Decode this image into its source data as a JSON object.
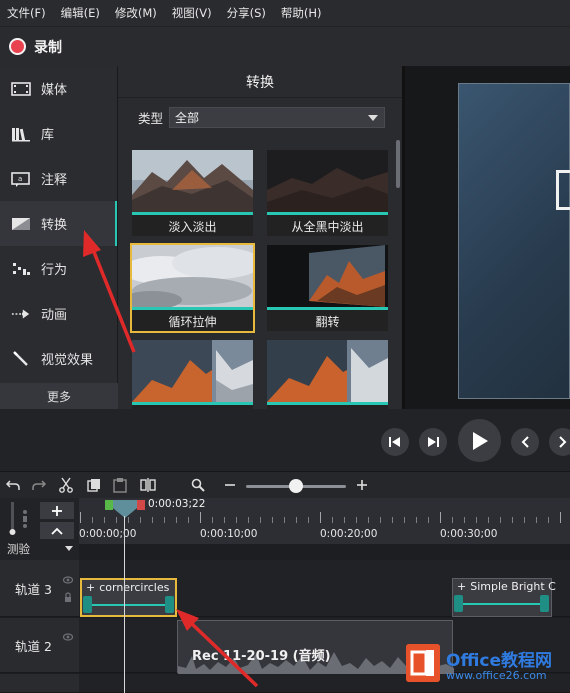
{
  "menu": [
    "文件(F)",
    "编辑(E)",
    "修改(M)",
    "视图(V)",
    "分享(S)",
    "帮助(H)"
  ],
  "record_label": "录制",
  "tools": [
    {
      "label": "媒体",
      "icon": "film-icon"
    },
    {
      "label": "库",
      "icon": "library-icon"
    },
    {
      "label": "注释",
      "icon": "annotation-icon"
    },
    {
      "label": "转换",
      "icon": "transition-icon",
      "active": true
    },
    {
      "label": "行为",
      "icon": "behavior-icon"
    },
    {
      "label": "动画",
      "icon": "animation-icon"
    },
    {
      "label": "视觉效果",
      "icon": "magic-wand-icon"
    }
  ],
  "tools_more": "更多",
  "panel": {
    "title": "转换",
    "filter_label": "类型",
    "filter_value": "全部",
    "items": [
      {
        "label": "淡入淡出"
      },
      {
        "label": "从全黑中淡出"
      },
      {
        "label": "循环拉伸",
        "selected": true
      },
      {
        "label": "翻转"
      },
      {
        "label": ""
      },
      {
        "label": ""
      }
    ]
  },
  "timeline": {
    "playhead_time": "0:00:03;22",
    "ticks": [
      "0:00:00;00",
      "0:00:10;00",
      "0:00:20;00",
      "0:00:30;00"
    ],
    "track_select": "测验",
    "tracks": [
      {
        "name": "轨道 3"
      },
      {
        "name": "轨道 2"
      }
    ],
    "clips": {
      "cornercircles": "cornercircles",
      "simple_bright": "Simple Bright C",
      "audio": "Rec 11-20-19 (音频)"
    }
  },
  "watermark": {
    "main": "Office教程网",
    "sub": "www.office26.com"
  },
  "colors": {
    "accent_teal": "#27c7b4",
    "selection_gold": "#e7b93c",
    "record_red": "#e8434f",
    "annotation_red": "#e02a2a"
  }
}
